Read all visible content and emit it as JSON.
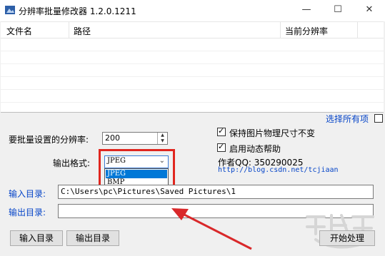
{
  "window": {
    "title": "分辨率批量修改器 1.2.0.1211",
    "minimize_glyph": "—",
    "maximize_glyph": "☐",
    "close_glyph": "✕"
  },
  "list": {
    "columns": [
      "文件名",
      "路径",
      "当前分辨率"
    ]
  },
  "select_all_label": "选择所有项",
  "batch_resolution": {
    "label": "要批量设置的分辨率:",
    "value": "200"
  },
  "output_format": {
    "label": "输出格式:",
    "selected": "JPEG",
    "options": [
      "JPEG",
      "BMP"
    ]
  },
  "options": {
    "keep_physical_size": {
      "label": "保持图片物理尺寸不变",
      "checked": true
    },
    "dynamic_help": {
      "label": "启用动态帮助",
      "checked": true
    }
  },
  "author": {
    "qq": "作者QQ: 350290025",
    "url": "http://blog.csdn.net/tcjiaan"
  },
  "input_dir": {
    "label": "输入目录:",
    "value": "C:\\Users\\pc\\Pictures\\Saved Pictures\\1"
  },
  "output_dir": {
    "label": "输出目录:",
    "value": ""
  },
  "buttons": {
    "input_dir": "输入目录",
    "output_dir": "输出目录",
    "start": "开始处理"
  },
  "colors": {
    "highlight_box": "#e0261f",
    "arrow": "#d9282a",
    "link_blue": "#0645c8",
    "selection_blue": "#0078d7"
  }
}
